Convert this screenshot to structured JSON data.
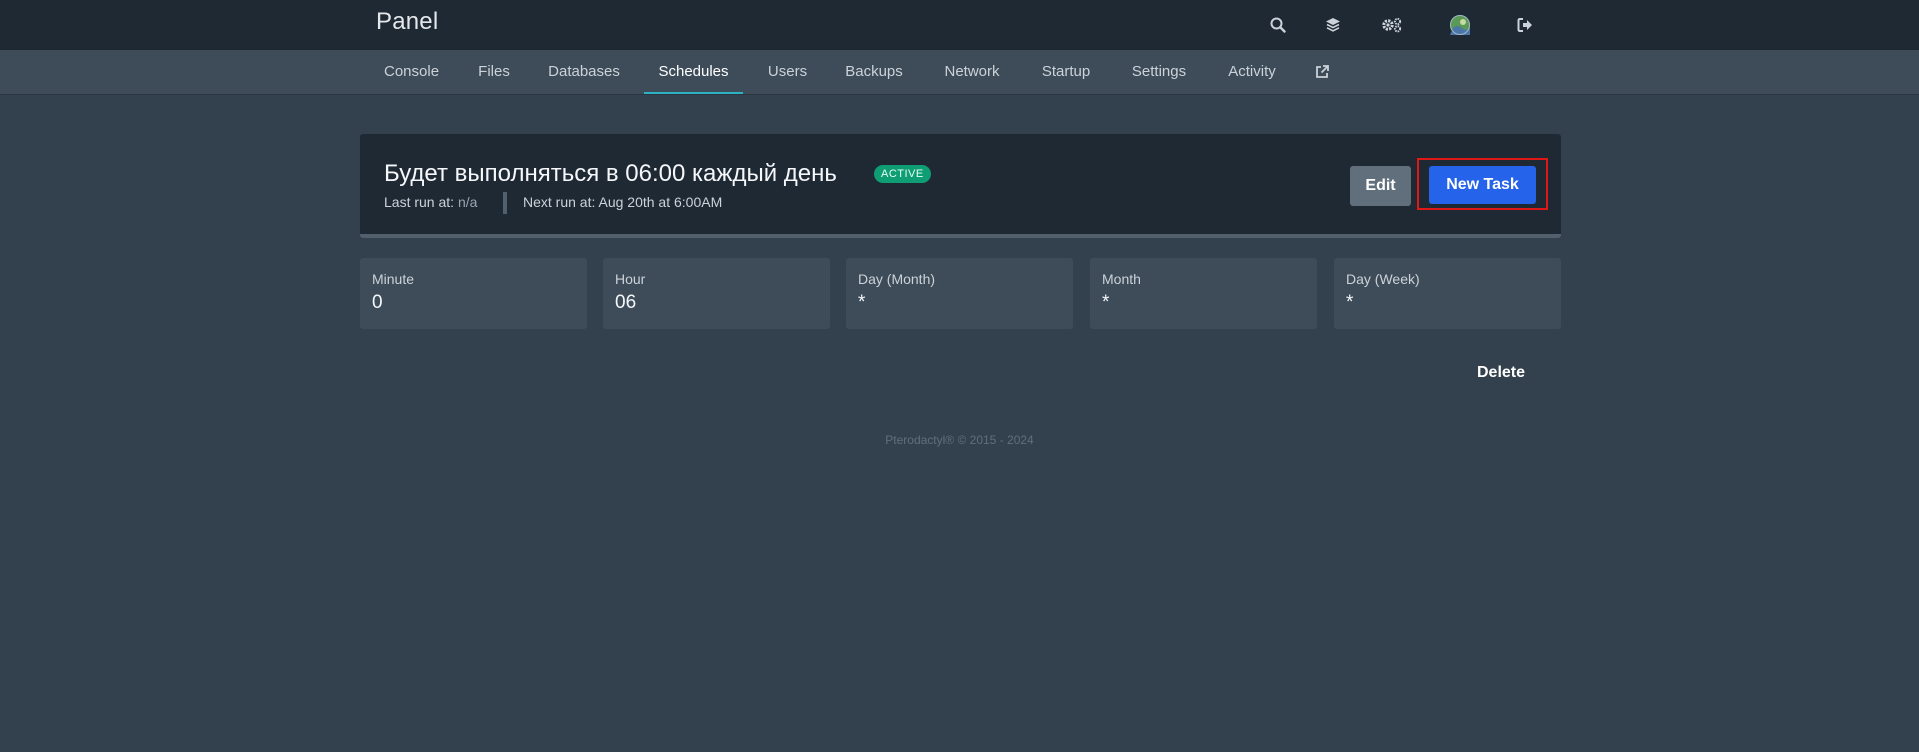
{
  "app": {
    "brand": "Panel"
  },
  "header_icons": [
    "search-icon",
    "layers-icon",
    "cogs-icon",
    "avatar",
    "sign-out-icon"
  ],
  "nav": {
    "tabs": [
      "Console",
      "Files",
      "Databases",
      "Schedules",
      "Users",
      "Backups",
      "Network",
      "Startup",
      "Settings",
      "Activity"
    ],
    "active": "Schedules",
    "external_icon": "external-link-icon"
  },
  "schedule": {
    "title": "Будет выполняться в 06:00 каждый день",
    "status": "ACTIVE",
    "last_run_label": "Last run at:",
    "last_run_value": "n/a",
    "next_run": "Next run at: Aug 20th at 6:00AM",
    "edit_label": "Edit",
    "new_task_label": "New Task",
    "delete_label": "Delete"
  },
  "cron": [
    {
      "label": "Minute",
      "value": "0"
    },
    {
      "label": "Hour",
      "value": "06"
    },
    {
      "label": "Day (Month)",
      "value": "*"
    },
    {
      "label": "Month",
      "value": "*"
    },
    {
      "label": "Day (Week)",
      "value": "*"
    }
  ],
  "footer": "Pterodactyl® © 2015 - 2024",
  "colors": {
    "background": "#33404d",
    "topbar": "#1f2933",
    "subnav": "#3e4c59",
    "accent": "#2bb0c4",
    "primary_button": "#2563eb",
    "badge_active": "#0f9d73",
    "highlight_box": "#e01717"
  }
}
